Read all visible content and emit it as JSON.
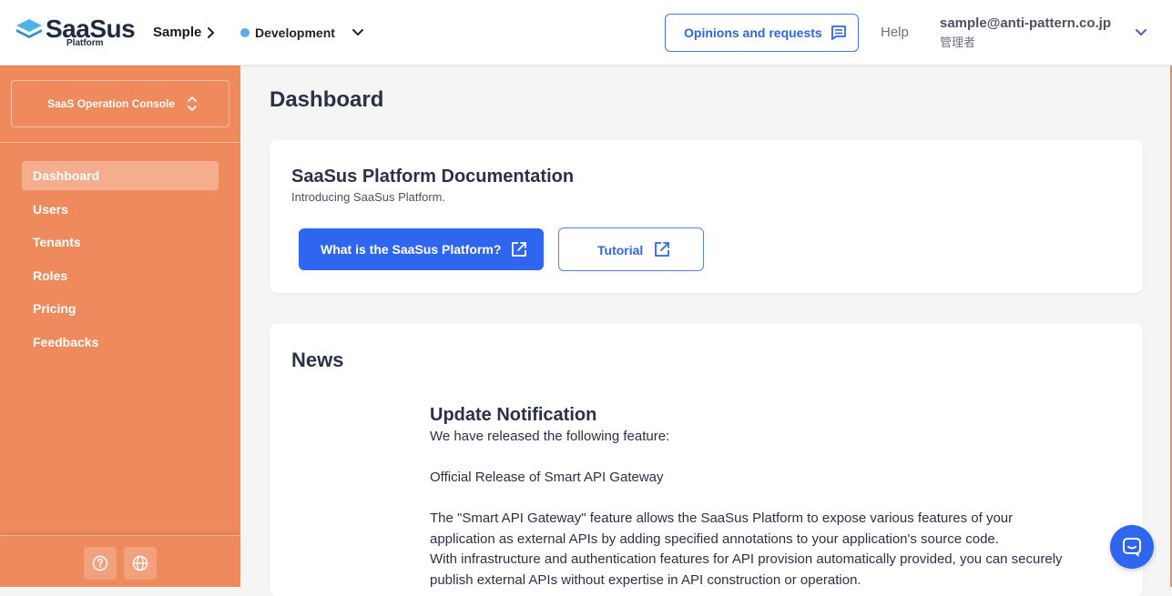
{
  "colors": {
    "sidebar_bg": "#ef8a5c",
    "primary": "#2f66f0",
    "environment_dot": "#5aaee8"
  },
  "header": {
    "logo_text": "SaaSus",
    "logo_subtext": "Platform",
    "app_name": "Sample",
    "environment": "Development",
    "opinions_button": "Opinions and requests",
    "help_link": "Help",
    "user_email": "sample@anti-pattern.co.jp",
    "user_role": "管理者"
  },
  "sidebar": {
    "console_switch": "SaaS Operation Console",
    "items": [
      {
        "label": "Dashboard",
        "active": true
      },
      {
        "label": "Users",
        "active": false
      },
      {
        "label": "Tenants",
        "active": false
      },
      {
        "label": "Roles",
        "active": false
      },
      {
        "label": "Pricing",
        "active": false
      },
      {
        "label": "Feedbacks",
        "active": false
      }
    ],
    "footer_icons": [
      "help-circle-icon",
      "globe-icon"
    ]
  },
  "main": {
    "page_title": "Dashboard",
    "docs_card": {
      "title": "SaaSus Platform Documentation",
      "subtitle": "Introducing SaaSus Platform.",
      "primary_button": "What is the SaaSus Platform?",
      "secondary_button": "Tutorial"
    },
    "news_card": {
      "title": "News",
      "item": {
        "title": "Update Notification",
        "lines": [
          "We have released the following feature:",
          "",
          "Official Release of Smart API Gateway",
          "",
          "The \"Smart API Gateway\" feature allows the SaaSus Platform to expose various features of your",
          "application as external APIs by adding specified annotations to your application's source code.",
          "With infrastructure and authentication features for API provision automatically provided, you can securely",
          "publish external APIs without expertise in API construction or operation."
        ]
      }
    }
  },
  "chat_widget": {
    "icon": "chat-icon"
  }
}
